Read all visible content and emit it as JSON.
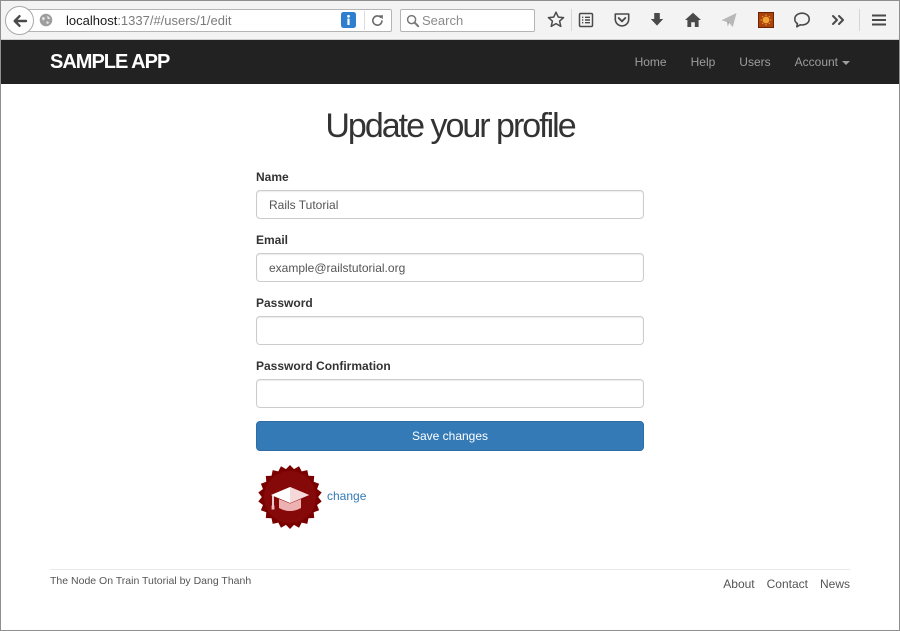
{
  "browser": {
    "url": {
      "host": "localhost",
      "path": ":1337/#/users/1/edit"
    },
    "search_placeholder": "Search",
    "icons": {
      "back": "back-arrow-icon",
      "identity": "globe-icon",
      "info": "info-icon",
      "reload": "reload-icon",
      "search": "search-icon",
      "toolbar": [
        "star-icon",
        "bookmarks-list-icon",
        "pocket-icon",
        "download-icon",
        "home-icon",
        "paper-plane-icon",
        "orange-extension-icon",
        "speech-bubble-icon",
        "double-chevron-icon",
        "hamburger-menu-icon"
      ]
    }
  },
  "navbar": {
    "brand": "SAMPLE APP",
    "links": [
      {
        "label": "Home"
      },
      {
        "label": "Help"
      },
      {
        "label": "Users"
      },
      {
        "label": "Account",
        "icon": "caret-down-icon"
      }
    ]
  },
  "page": {
    "title": "Update your profile"
  },
  "form": {
    "name": {
      "label": "Name",
      "value": "Rails Tutorial"
    },
    "email": {
      "label": "Email",
      "value": "example@railstutorial.org"
    },
    "password": {
      "label": "Password",
      "value": ""
    },
    "password_confirmation": {
      "label": "Password Confirmation",
      "value": ""
    },
    "submit_label": "Save changes"
  },
  "gravatar": {
    "icon": "graduation-cap-starburst",
    "change_label": "change"
  },
  "footer": {
    "credit": {
      "prefix": "The",
      "project": "Node On Train Tutorial",
      "by": "by",
      "author": "Dang Thanh"
    },
    "links": [
      {
        "label": "About"
      },
      {
        "label": "Contact"
      },
      {
        "label": "News"
      }
    ]
  },
  "colors": {
    "navbar_bg": "#222222",
    "brand": "#ffffff",
    "nav_link": "#9d9d9d",
    "primary": "#337ab7",
    "link": "#337ab7",
    "text": "#333333",
    "footer_text": "#555555",
    "badge": "#7a0000"
  }
}
